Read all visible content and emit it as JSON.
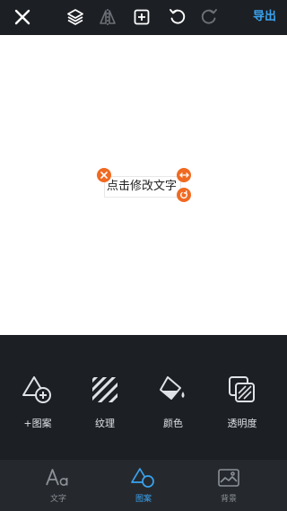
{
  "toolbar": {
    "close_icon": "close-icon",
    "layers_icon": "layers-icon",
    "flip_icon": "flip-icon",
    "add_icon": "add-square-icon",
    "undo_icon": "undo-icon",
    "redo_icon": "redo-icon",
    "export_label": "导出"
  },
  "canvas": {
    "text_element": "点击修改文字",
    "handles": [
      "delete-handle-icon",
      "stretch-handle-icon",
      "rotate-handle-icon"
    ]
  },
  "tools": [
    {
      "label": "+图案",
      "icon": "add-shape-icon"
    },
    {
      "label": "纹理",
      "icon": "texture-icon"
    },
    {
      "label": "颜色",
      "icon": "paint-bucket-icon"
    },
    {
      "label": "透明度",
      "icon": "opacity-icon"
    }
  ],
  "tabs": [
    {
      "label": "文字",
      "icon": "text-aa-icon",
      "active": false
    },
    {
      "label": "图案",
      "icon": "shape-icon",
      "active": true
    },
    {
      "label": "背景",
      "icon": "background-image-icon",
      "active": false
    }
  ],
  "colors": {
    "accent": "#3aa3f0",
    "handle": "#f06a22",
    "toolbar_bg": "#1c1f23",
    "tabbar_bg": "#25292e"
  }
}
